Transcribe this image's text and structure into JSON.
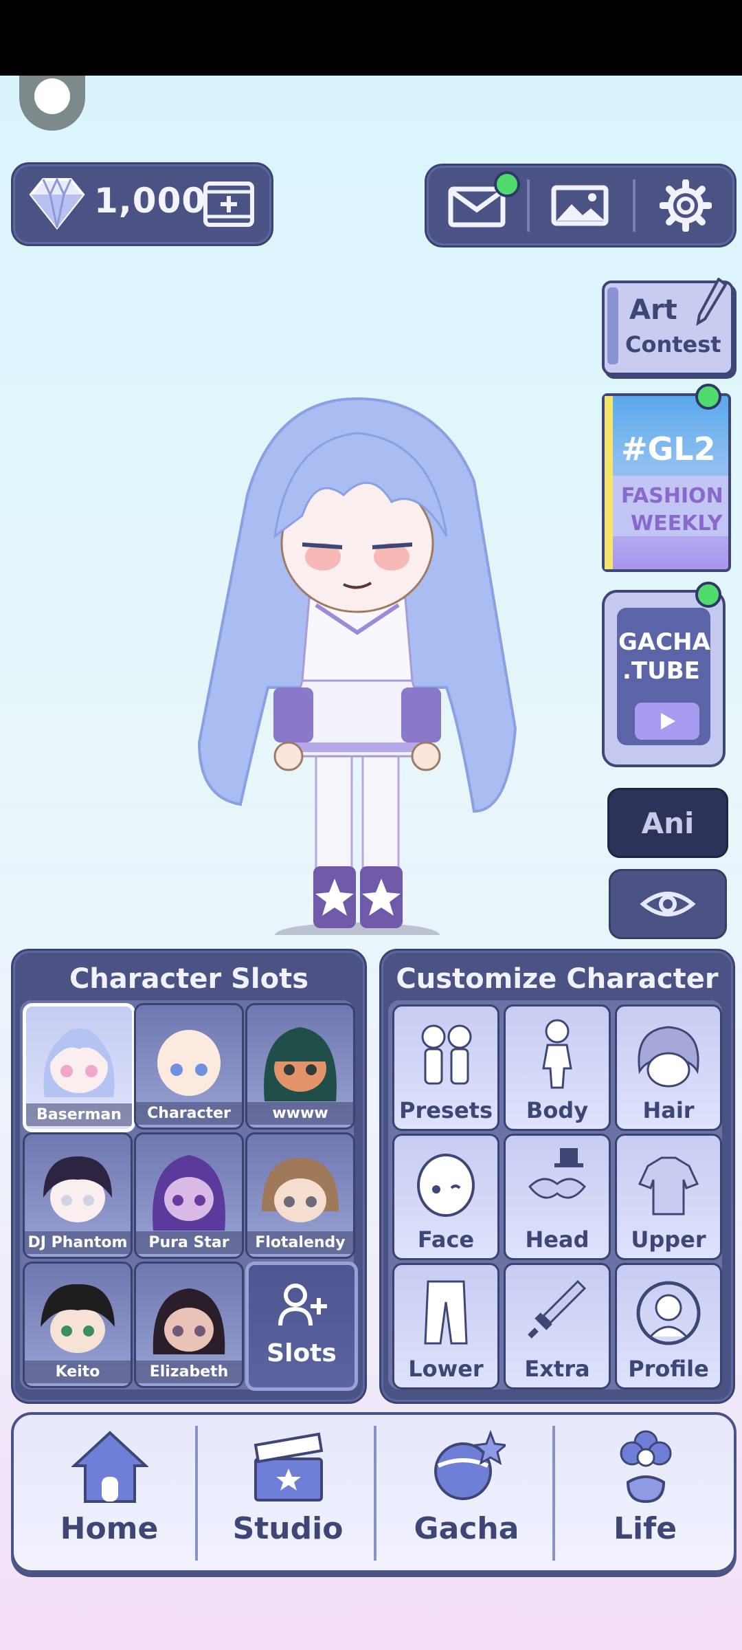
{
  "currency": {
    "amount": "1,000",
    "icon": "diamond-icon"
  },
  "top_buttons": {
    "mail": "envelope-icon",
    "gallery": "image-icon",
    "settings": "gear-icon"
  },
  "side_menu": {
    "art_contest": {
      "title": "Art",
      "subtitle": "Contest"
    },
    "gl2": {
      "title": "#GL2",
      "line1": "FASHION",
      "line2": "WEEKLY"
    },
    "gacha_tube": {
      "line1": "GACHA",
      "line2": ".TUBE"
    },
    "ani_label": "Ani"
  },
  "slots_panel": {
    "title": "Character Slots",
    "slots": [
      {
        "label": "Baserman"
      },
      {
        "label": "Character"
      },
      {
        "label": "wwww"
      },
      {
        "label": "DJ Phantom"
      },
      {
        "label": "Pura Star"
      },
      {
        "label": "Flotalendy"
      },
      {
        "label": "Keito"
      },
      {
        "label": "Elizabeth"
      }
    ],
    "add_label": "Slots"
  },
  "customize_panel": {
    "title": "Customize Character",
    "items": [
      {
        "label": "Presets"
      },
      {
        "label": "Body"
      },
      {
        "label": "Hair"
      },
      {
        "label": "Face"
      },
      {
        "label": "Head"
      },
      {
        "label": "Upper"
      },
      {
        "label": "Lower"
      },
      {
        "label": "Extra"
      },
      {
        "label": "Profile"
      }
    ]
  },
  "bottom_nav": {
    "items": [
      {
        "label": "Home"
      },
      {
        "label": "Studio"
      },
      {
        "label": "Gacha"
      },
      {
        "label": "Life"
      }
    ]
  },
  "colors": {
    "panel": "#4a5384",
    "accent": "#3e4676",
    "notification": "#4fdc6c"
  }
}
